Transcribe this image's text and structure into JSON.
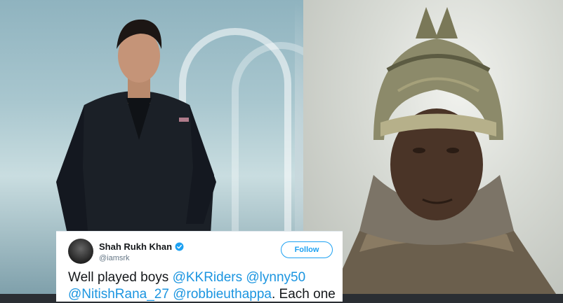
{
  "tweet": {
    "name": "Shah Rukh Khan",
    "handle": "@iamsrk",
    "follow_label": "Follow",
    "text_lead": "Well played boys ",
    "mention_1": "@KKRiders",
    "mention_2": "@lynny50",
    "mention_3": "@NitishRana_27",
    "mention_4": "@robbieuthappa",
    "text_tail": ". Each one"
  },
  "colors": {
    "accent": "#1da1f2",
    "mention": "#1b95e0",
    "text": "#14171a",
    "muted": "#657786"
  },
  "icons": {
    "verified": "verified-badge-icon",
    "avatar": "avatar"
  }
}
